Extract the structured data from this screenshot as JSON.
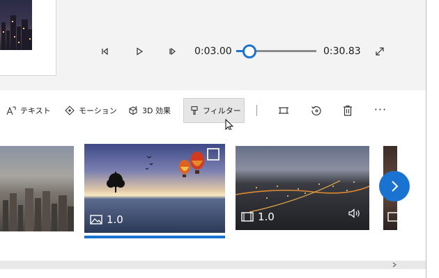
{
  "player": {
    "current_time": "0:03.00",
    "total_time": "0:30.83",
    "progress_fraction": 0.097
  },
  "toolbar": {
    "text_label": "テキスト",
    "motion_label": "モーション",
    "effects_label": "3D 効果",
    "filter_label": "フィルター",
    "more_label": "···"
  },
  "storyboard": {
    "clips": [
      {
        "duration": "",
        "kind": "image"
      },
      {
        "duration": "1.0",
        "kind": "image",
        "selected": true
      },
      {
        "duration": "1.0",
        "kind": "video"
      },
      {
        "duration": "",
        "kind": "image"
      }
    ]
  },
  "colors": {
    "accent": "#1a73d1",
    "active_button_bg": "#e6e6e6",
    "panel_bg": "#f3f3f3"
  },
  "icons": [
    "prev-frame-icon",
    "play-icon",
    "next-frame-icon",
    "fullscreen-icon",
    "text-icon",
    "motion-icon",
    "3d-effects-icon",
    "filter-icon",
    "crop-icon",
    "rotate-icon",
    "delete-icon",
    "more-icon",
    "image-icon",
    "video-icon",
    "speaker-icon",
    "chevron-right-icon"
  ]
}
